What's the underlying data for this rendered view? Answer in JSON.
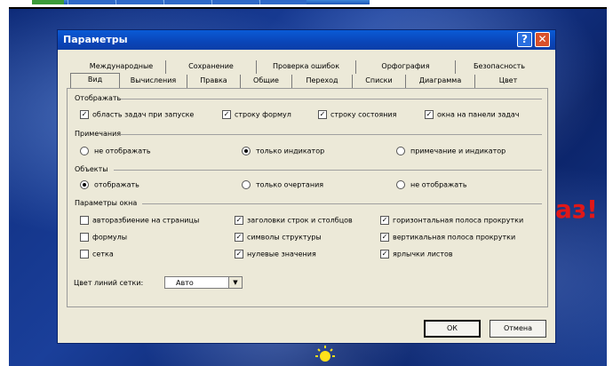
{
  "window": {
    "title": "Параметры",
    "help_glyph": "?",
    "close_glyph": "✕"
  },
  "tabs_back": [
    "Международные",
    "Сохранение",
    "Проверка ошибок",
    "Орфография",
    "Безопасность"
  ],
  "tabs_front": [
    "Вид",
    "Вычисления",
    "Правка",
    "Общие",
    "Переход",
    "Списки",
    "Диаграмма",
    "Цвет"
  ],
  "active_tab": "Вид",
  "show": {
    "title": "Отображать",
    "items": [
      {
        "label": "область задач при запуске",
        "checked": true
      },
      {
        "label": "строку формул",
        "checked": true
      },
      {
        "label": "строку состояния",
        "checked": true
      },
      {
        "label": "окна на панели задач",
        "checked": true
      }
    ]
  },
  "comments": {
    "title": "Примечания",
    "options": [
      {
        "label": "не отображать",
        "selected": false
      },
      {
        "label": "только индикатор",
        "selected": true
      },
      {
        "label": "примечание и индикатор",
        "selected": false
      }
    ]
  },
  "objects": {
    "title": "Объекты",
    "options": [
      {
        "label": "отображать",
        "selected": true
      },
      {
        "label": "только очертания",
        "selected": false
      },
      {
        "label": "не отображать",
        "selected": false
      }
    ]
  },
  "window_options": {
    "title": "Параметры окна",
    "col1": [
      {
        "label": "авторазбиение на страницы",
        "checked": false
      },
      {
        "label": "формулы",
        "checked": false
      },
      {
        "label": "сетка",
        "checked": false
      }
    ],
    "col2": [
      {
        "label": "заголовки строк и столбцов",
        "checked": true
      },
      {
        "label": "символы структуры",
        "checked": true
      },
      {
        "label": "нулевые значения",
        "checked": true
      }
    ],
    "col3": [
      {
        "label": "горизонтальная полоса прокрутки",
        "checked": true
      },
      {
        "label": "вертикальная полоса прокрутки",
        "checked": true
      },
      {
        "label": "ярлычки листов",
        "checked": true
      }
    ],
    "grid_color_label": "Цвет линий сетки:",
    "grid_color_value": "Авто"
  },
  "buttons": {
    "ok": "ОК",
    "cancel": "Отмена"
  },
  "desktop_text": "аз!",
  "colors": {
    "title_bar": "#0a45b8",
    "close_button": "#d8502a",
    "dialog_face": "#ece9d8",
    "desktop": "#163a8e",
    "desktop_text": "#e01818"
  }
}
